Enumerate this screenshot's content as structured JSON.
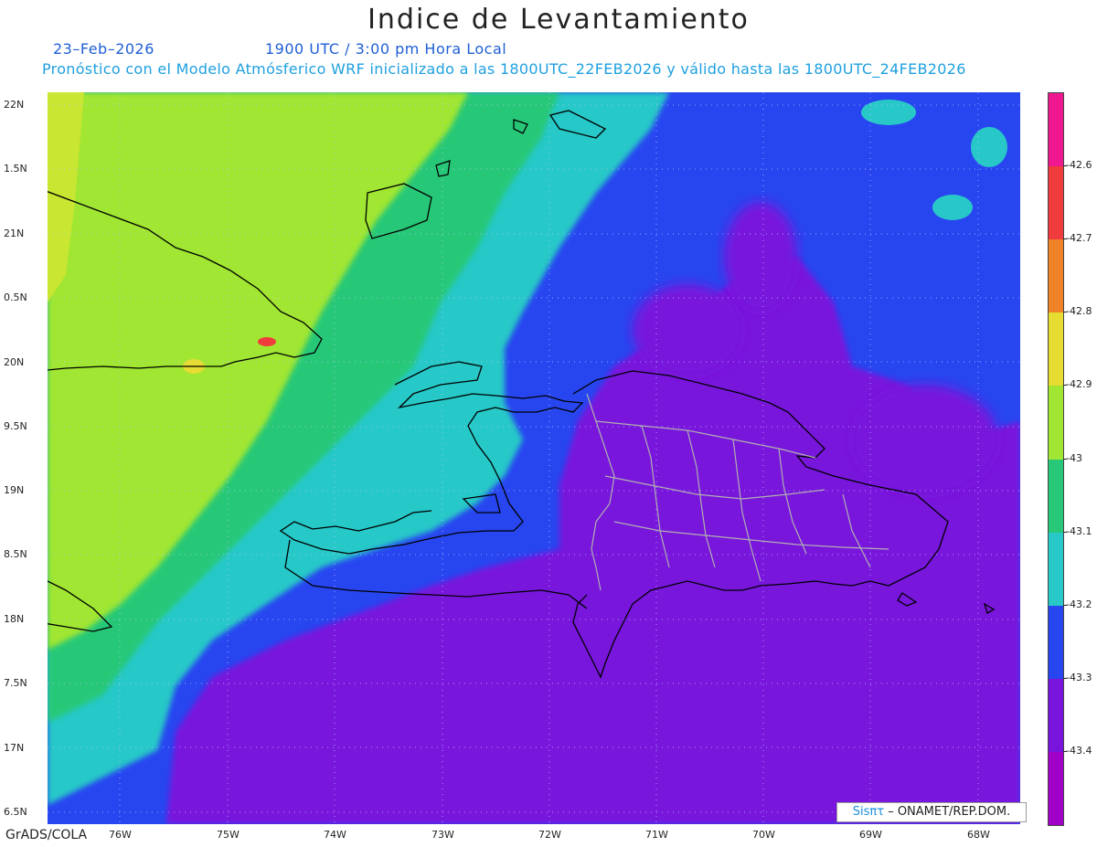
{
  "title": "Indice de Levantamiento",
  "date": "23–Feb–2026",
  "time": "1900 UTC / 3:00 pm Hora Local",
  "subtitle": "Pronóstico con el Modelo Atmósferico WRF inicializado a las 1800UTC_22FEB2026 y válido hasta las  1800UTC_24FEB2026",
  "footer": "GrADS/COLA",
  "credit_logo": "Sisπτ",
  "credit_text": " – ONAMET/REP.DOM.",
  "lat_labels": [
    "22N",
    "1.5N",
    "21N",
    "0.5N",
    "20N",
    "9.5N",
    "19N",
    "8.5N",
    "18N",
    "7.5N",
    "17N",
    "6.5N"
  ],
  "lon_labels": [
    "76W",
    "75W",
    "74W",
    "73W",
    "72W",
    "71W",
    "70W",
    "69W",
    "68W"
  ],
  "colorbar": {
    "labels": [
      "-42.6",
      "-42.7",
      "-42.8",
      "-42.9",
      "-43",
      "-43.1",
      "-43.2",
      "-43.3",
      "-43.4"
    ],
    "colors": [
      "#f01890",
      "#f03c3c",
      "#f08228",
      "#e6dc32",
      "#a0e632",
      "#28c878",
      "#28c8c8",
      "#2846f0",
      "#7814dc",
      "#a000c8"
    ]
  },
  "map_colors": {
    "yellow_green": "#a0e632",
    "light_green": "#c8e632",
    "green": "#28c878",
    "cyan": "#28c8c8",
    "blue": "#2846f0",
    "purple": "#7814dc",
    "magenta": "#a000c8"
  }
}
